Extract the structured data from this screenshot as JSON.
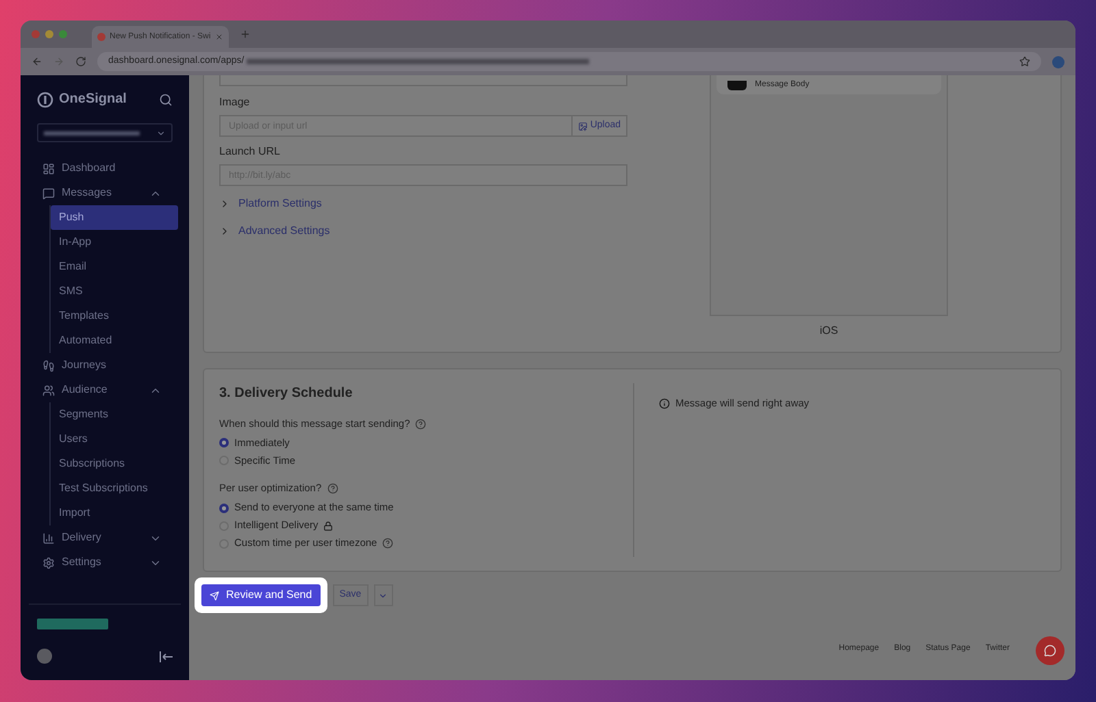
{
  "browser": {
    "tab_title": "New Push Notification - Swi",
    "url": "dashboard.onesignal.com/apps/"
  },
  "sidebar": {
    "brand": "OneSignal",
    "items": [
      {
        "label": "Dashboard",
        "selected": false
      },
      {
        "label": "Messages",
        "selected": false,
        "expanded": true,
        "children": [
          {
            "label": "Push",
            "selected": true
          },
          {
            "label": "In-App",
            "selected": false
          },
          {
            "label": "Email",
            "selected": false
          },
          {
            "label": "SMS",
            "selected": false
          },
          {
            "label": "Templates",
            "selected": false
          },
          {
            "label": "Automated",
            "selected": false
          }
        ]
      },
      {
        "label": "Journeys",
        "selected": false
      },
      {
        "label": "Audience",
        "selected": false,
        "expanded": true,
        "children": [
          {
            "label": "Segments",
            "selected": false
          },
          {
            "label": "Users",
            "selected": false
          },
          {
            "label": "Subscriptions",
            "selected": false
          },
          {
            "label": "Test Subscriptions",
            "selected": false
          },
          {
            "label": "Import",
            "selected": false
          }
        ]
      },
      {
        "label": "Delivery",
        "selected": false,
        "expanded": false
      },
      {
        "label": "Settings",
        "selected": false,
        "expanded": false
      }
    ]
  },
  "content": {
    "image": {
      "label": "Image",
      "placeholder": "Upload or input url",
      "button": "Upload"
    },
    "launch_url": {
      "label": "Launch URL",
      "placeholder": "http://bit.ly/abc"
    },
    "sections": [
      {
        "label": "Platform Settings",
        "expanded": false
      },
      {
        "label": "Advanced Settings",
        "expanded": false
      }
    ],
    "preview": {
      "notification_body": "Message Body",
      "platform": "iOS"
    }
  },
  "delivery": {
    "title": "3. Delivery Schedule",
    "groups": [
      {
        "question": "When should this message start sending?",
        "options": [
          {
            "label": "Immediately",
            "selected": true
          },
          {
            "label": "Specific Time",
            "selected": false
          }
        ]
      },
      {
        "question": "Per user optimization?",
        "options": [
          {
            "label": "Send to everyone at the same time",
            "selected": true
          },
          {
            "label": "Intelligent Delivery",
            "selected": false,
            "locked": true
          },
          {
            "label": "Custom time per user timezone",
            "selected": false,
            "help": true
          }
        ]
      }
    ],
    "info": "Message will send right away"
  },
  "actions": {
    "primary": "Review and Send",
    "secondary": "Save"
  },
  "footer": [
    "Homepage",
    "Blog",
    "Status Page",
    "Twitter"
  ]
}
